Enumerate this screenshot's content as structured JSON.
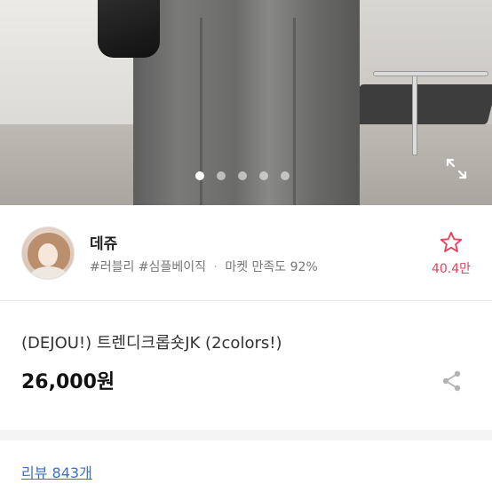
{
  "carousel": {
    "slide_count": 5,
    "active_index": 0
  },
  "seller": {
    "name": "데쥬",
    "tag_1": "#러블리",
    "tag_2": "#심플베이직",
    "separator": "·",
    "satisfaction_label": "마켓 만족도",
    "satisfaction_value": "92%",
    "favorite_count": "40.4만"
  },
  "product": {
    "title": "(DEJOU!) 트렌디크롭숏JK (2colors!)",
    "price": "26,000원"
  },
  "reviews": {
    "label": "리뷰 843개"
  },
  "colors": {
    "accent_pink": "#e8415d",
    "link_blue": "#3b6fc4"
  },
  "icons": [
    "expand-icon",
    "star-outline-icon",
    "share-icon"
  ]
}
